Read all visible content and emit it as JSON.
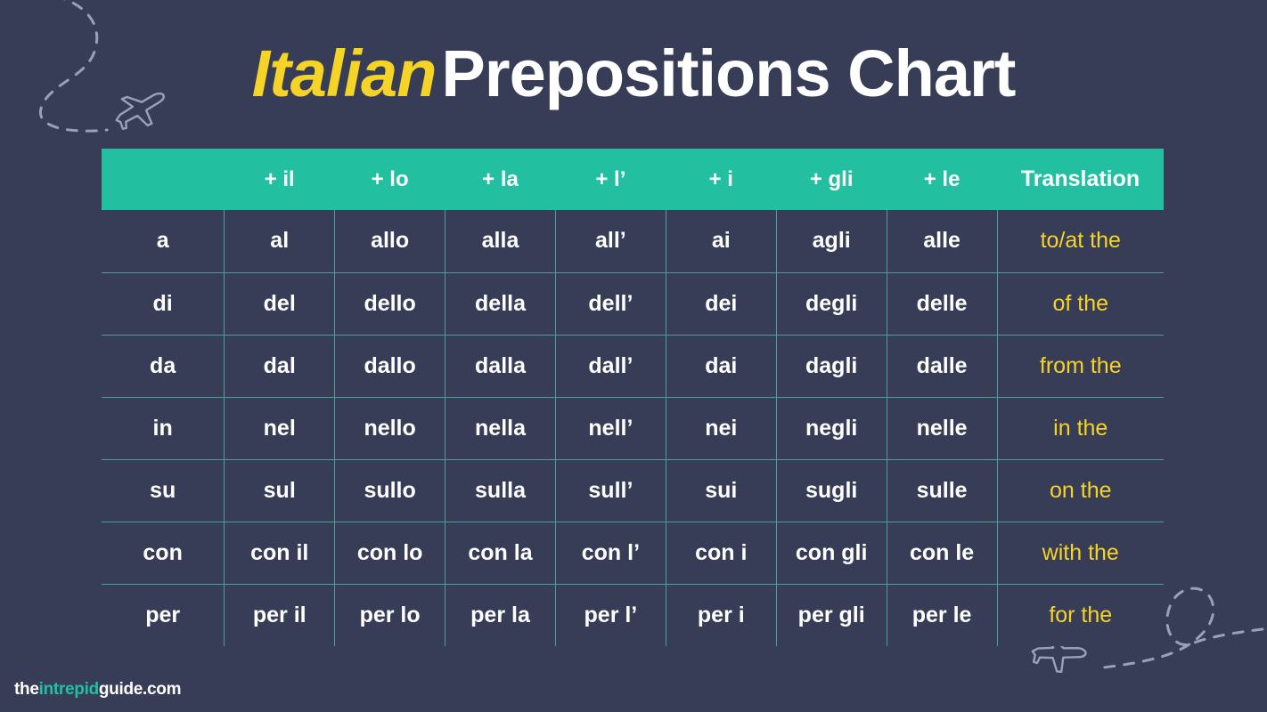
{
  "title": {
    "accent": "Italian",
    "rest": "Prepositions Chart"
  },
  "colors": {
    "background": "#383d57",
    "header_teal": "#22c0a1",
    "accent_yellow": "#f5d327",
    "grid_line": "#4c9f94",
    "text_white": "#ffffff"
  },
  "footer": {
    "logo_part1": "the",
    "logo_part2": "intrepid",
    "logo_part3": "guide.com"
  },
  "decorations": [
    {
      "name": "flight-path-top-left",
      "icon": "airplane-icon"
    },
    {
      "name": "flight-path-bottom-right",
      "icon": "airplane-icon"
    }
  ],
  "chart_data": {
    "type": "table",
    "title": "Italian Prepositions Chart",
    "columns": [
      "",
      "+ il",
      "+ lo",
      "+ la",
      "+ l’",
      "+ i",
      "+ gli",
      "+ le",
      "Translation"
    ],
    "rows": [
      {
        "preposition": "a",
        "forms": [
          "al",
          "allo",
          "alla",
          "all’",
          "ai",
          "agli",
          "alle"
        ],
        "translation": "to/at the"
      },
      {
        "preposition": "di",
        "forms": [
          "del",
          "dello",
          "della",
          "dell’",
          "dei",
          "degli",
          "delle"
        ],
        "translation": "of the"
      },
      {
        "preposition": "da",
        "forms": [
          "dal",
          "dallo",
          "dalla",
          "dall’",
          "dai",
          "dagli",
          "dalle"
        ],
        "translation": "from the"
      },
      {
        "preposition": "in",
        "forms": [
          "nel",
          "nello",
          "nella",
          "nell’",
          "nei",
          "negli",
          "nelle"
        ],
        "translation": "in the"
      },
      {
        "preposition": "su",
        "forms": [
          "sul",
          "sullo",
          "sulla",
          "sull’",
          "sui",
          "sugli",
          "sulle"
        ],
        "translation": "on the"
      },
      {
        "preposition": "con",
        "forms": [
          "con il",
          "con lo",
          "con la",
          "con l’",
          "con i",
          "con gli",
          "con le"
        ],
        "translation": "with the"
      },
      {
        "preposition": "per",
        "forms": [
          "per il",
          "per lo",
          "per la",
          "per l’",
          "per i",
          "per gli",
          "per le"
        ],
        "translation": "for the"
      }
    ]
  }
}
